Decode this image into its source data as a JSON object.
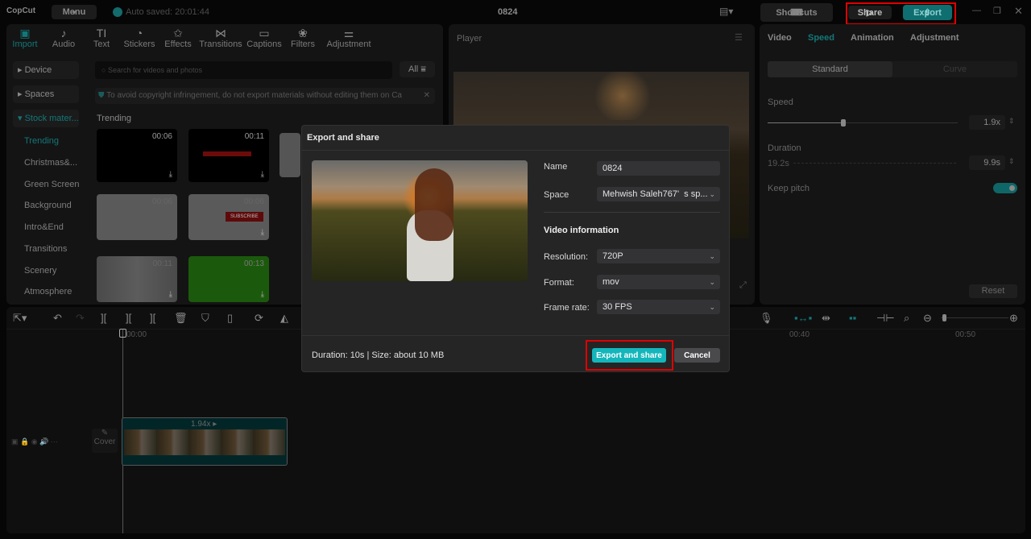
{
  "app": {
    "logo": "CopCut",
    "menu": "Menu",
    "autosave": "Auto saved: 20:01:44",
    "project_title": "0824",
    "shortcuts": "Shortcuts",
    "share": "Share",
    "export": "Export",
    "accent": "#1a9e9f",
    "highlight": "#e00000"
  },
  "media_tabs": [
    {
      "label": "Import",
      "icon": "import-icon"
    },
    {
      "label": "Audio",
      "icon": "audio-icon"
    },
    {
      "label": "Text",
      "icon": "text-icon"
    },
    {
      "label": "Stickers",
      "icon": "stickers-icon"
    },
    {
      "label": "Effects",
      "icon": "effects-icon"
    },
    {
      "label": "Transitions",
      "icon": "transitions-icon"
    },
    {
      "label": "Captions",
      "icon": "captions-icon"
    },
    {
      "label": "Filters",
      "icon": "filters-icon"
    },
    {
      "label": "Adjustment",
      "icon": "adjustment-icon"
    }
  ],
  "sidebar": {
    "sections": [
      "Device",
      "Spaces",
      "Stock mater..."
    ],
    "items": [
      "Trending",
      "Christmas&...",
      "Green Screen",
      "Background",
      "Intro&End",
      "Transitions",
      "Scenery",
      "Atmosphere"
    ]
  },
  "library": {
    "search_placeholder": "Search for videos and photos",
    "filter": "All",
    "notice": "To avoid copyright infringement, do not export materials without editing them on Ca",
    "section": "Trending",
    "durations": [
      "00:06",
      "00:11",
      "00:06",
      "00:06",
      "00:11",
      "00:13"
    ],
    "subscribe": "SUBSCRIBE"
  },
  "player": {
    "title": "Player"
  },
  "inspector": {
    "tabs": [
      "Video",
      "Speed",
      "Animation",
      "Adjustment"
    ],
    "active_tab": "Speed",
    "modes": [
      "Standard",
      "Curve"
    ],
    "speed_label": "Speed",
    "speed_value": "1.9x",
    "speed_fraction": 0.4,
    "duration_label": "Duration",
    "duration_from": "19.2s",
    "duration_value": "9.9s",
    "keep_pitch": "Keep pitch",
    "keep_pitch_on": true,
    "reset": "Reset"
  },
  "timeline": {
    "ruler": [
      "00:00",
      "00:40",
      "00:50"
    ],
    "clip_speed": "1.94x",
    "cover": "Cover"
  },
  "dialog": {
    "title": "Export and share",
    "name_label": "Name",
    "name_value": "0824",
    "space_label": "Space",
    "space_value": "Mehwish Saleh767'  s sp...",
    "section": "Video information",
    "resolution_label": "Resolution:",
    "resolution_value": "720P",
    "format_label": "Format:",
    "format_value": "mov",
    "framerate_label": "Frame rate:",
    "framerate_value": "30 FPS",
    "summary": "Duration: 10s | Size: about 10 MB",
    "primary": "Export and share",
    "cancel": "Cancel"
  }
}
